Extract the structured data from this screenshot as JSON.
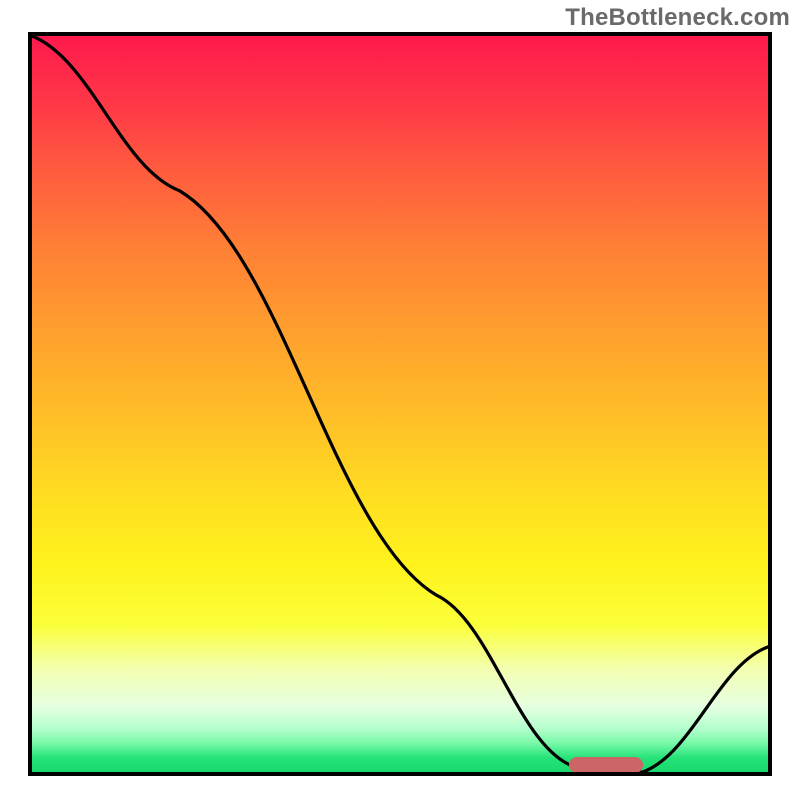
{
  "watermark": "TheBottleneck.com",
  "colors": {
    "gradient_top": "#ff1a4d",
    "gradient_bottom": "#17d76d",
    "curve": "#000000",
    "marker": "#cc6666",
    "border": "#000000"
  },
  "chart_data": {
    "type": "line",
    "title": "",
    "xlabel": "",
    "ylabel": "",
    "xlim": [
      0,
      100
    ],
    "ylim": [
      0,
      100
    ],
    "series": [
      {
        "name": "bottleneck-curve",
        "x": [
          0,
          20,
          55,
          73,
          78,
          83,
          100
        ],
        "values": [
          100,
          79,
          24,
          1,
          0,
          0,
          17
        ]
      }
    ],
    "annotations": [
      {
        "name": "optimal-range-marker",
        "x_start": 73,
        "x_end": 83,
        "y": 1,
        "color": "#cc6666"
      }
    ]
  }
}
